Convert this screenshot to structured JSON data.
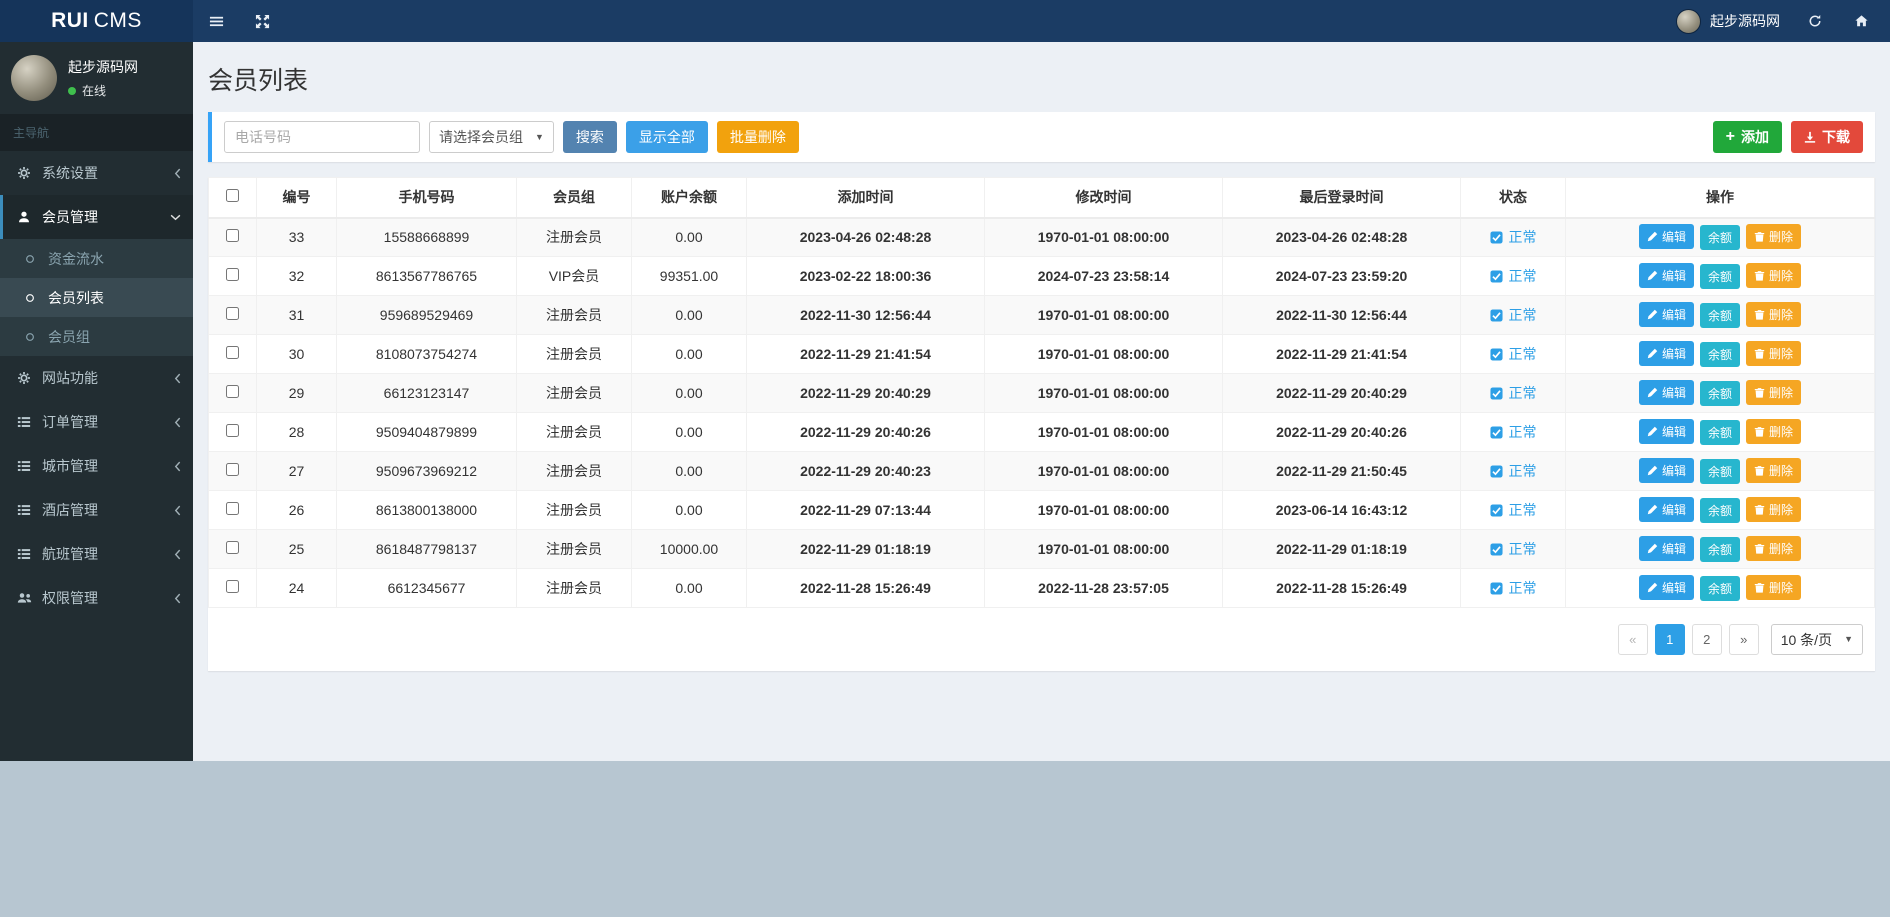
{
  "topbar": {
    "logo_bold": "RUI",
    "logo_light": "CMS",
    "user_name": "起步源码网",
    "icons": [
      "menu-icon",
      "fullscreen-icon",
      "avatar",
      "refresh-icon",
      "home-icon"
    ]
  },
  "sidebar": {
    "user_name": "起步源码网",
    "user_status": "在线",
    "nav_label": "主导航",
    "items": [
      {
        "label": "系统设置",
        "icon": "gears-icon"
      },
      {
        "label": "会员管理",
        "icon": "user-icon",
        "active": true,
        "expanded": true,
        "children": [
          {
            "label": "资金流水"
          },
          {
            "label": "会员列表",
            "active": true
          },
          {
            "label": "会员组"
          }
        ]
      },
      {
        "label": "网站功能",
        "icon": "gear-icon"
      },
      {
        "label": "订单管理",
        "icon": "list-icon"
      },
      {
        "label": "城市管理",
        "icon": "list-icon"
      },
      {
        "label": "酒店管理",
        "icon": "list-icon"
      },
      {
        "label": "航班管理",
        "icon": "list-icon"
      },
      {
        "label": "权限管理",
        "icon": "users-icon"
      }
    ]
  },
  "page": {
    "title": "会员列表"
  },
  "toolbar": {
    "phone_placeholder": "电话号码",
    "group_select_value": "请选择会员组",
    "search_label": "搜索",
    "show_all_label": "显示全部",
    "batch_delete_label": "批量删除",
    "add_label": "添加",
    "download_label": "下载"
  },
  "table": {
    "headers": [
      "编号",
      "手机号码",
      "会员组",
      "账户余额",
      "添加时间",
      "修改时间",
      "最后登录时间",
      "状态",
      "操作"
    ],
    "status_label": "正常",
    "actions": {
      "edit_label": "编辑",
      "balance_label": "余额",
      "delete_label": "删除"
    },
    "rows": [
      {
        "id": "33",
        "phone": "15588668899",
        "group": "注册会员",
        "balance": "0.00",
        "added_time": "2023-04-26 02:48:28",
        "modified_time": "1970-01-01 08:00:00",
        "last_login_time": "2023-04-26 02:48:28"
      },
      {
        "id": "32",
        "phone": "8613567786765",
        "group": "VIP会员",
        "balance": "99351.00",
        "added_time": "2023-02-22 18:00:36",
        "modified_time": "2024-07-23 23:58:14",
        "last_login_time": "2024-07-23 23:59:20"
      },
      {
        "id": "31",
        "phone": "959689529469",
        "group": "注册会员",
        "balance": "0.00",
        "added_time": "2022-11-30 12:56:44",
        "modified_time": "1970-01-01 08:00:00",
        "last_login_time": "2022-11-30 12:56:44"
      },
      {
        "id": "30",
        "phone": "8108073754274",
        "group": "注册会员",
        "balance": "0.00",
        "added_time": "2022-11-29 21:41:54",
        "modified_time": "1970-01-01 08:00:00",
        "last_login_time": "2022-11-29 21:41:54"
      },
      {
        "id": "29",
        "phone": "66123123147",
        "group": "注册会员",
        "balance": "0.00",
        "added_time": "2022-11-29 20:40:29",
        "modified_time": "1970-01-01 08:00:00",
        "last_login_time": "2022-11-29 20:40:29"
      },
      {
        "id": "28",
        "phone": "9509404879899",
        "group": "注册会员",
        "balance": "0.00",
        "added_time": "2022-11-29 20:40:26",
        "modified_time": "1970-01-01 08:00:00",
        "last_login_time": "2022-11-29 20:40:26"
      },
      {
        "id": "27",
        "phone": "9509673969212",
        "group": "注册会员",
        "balance": "0.00",
        "added_time": "2022-11-29 20:40:23",
        "modified_time": "1970-01-01 08:00:00",
        "last_login_time": "2022-11-29 21:50:45"
      },
      {
        "id": "26",
        "phone": "8613800138000",
        "group": "注册会员",
        "balance": "0.00",
        "added_time": "2022-11-29 07:13:44",
        "modified_time": "1970-01-01 08:00:00",
        "last_login_time": "2023-06-14 16:43:12"
      },
      {
        "id": "25",
        "phone": "8618487798137",
        "group": "注册会员",
        "balance": "10000.00",
        "added_time": "2022-11-29 01:18:19",
        "modified_time": "1970-01-01 08:00:00",
        "last_login_time": "2022-11-29 01:18:19"
      },
      {
        "id": "24",
        "phone": "6612345677",
        "group": "注册会员",
        "balance": "0.00",
        "added_time": "2022-11-28 15:26:49",
        "modified_time": "2022-11-28 23:57:05",
        "last_login_time": "2022-11-28 15:26:49"
      }
    ]
  },
  "pagination": {
    "prev_label": "«",
    "pages": [
      "1",
      "2"
    ],
    "active_page": "1",
    "next_label": "»",
    "page_size_value": "10 条/页"
  },
  "colors": {
    "accent_blue": "#36a3f7",
    "primary_blue": "#2d9fe6",
    "green": "#21a83a",
    "red": "#e3493b",
    "orange": "#f2a20d",
    "teal": "#27b6ce",
    "online_green": "#3fbf4d"
  }
}
